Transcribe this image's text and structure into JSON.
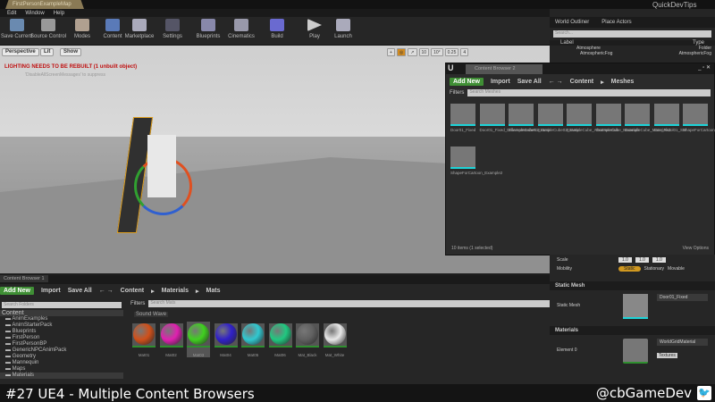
{
  "window": {
    "map_tab": "FirstPersonExampleMap",
    "project": "QuickDevTips",
    "menu": [
      "Edit",
      "Window",
      "Help"
    ]
  },
  "toolbar": [
    "Save Current",
    "Source Control",
    "Modes",
    "Content",
    "Marketplace",
    "Settings",
    "Blueprints",
    "Cinematics",
    "Build",
    "Play",
    "Launch"
  ],
  "viewport": {
    "perspective": "Perspective",
    "lit": "Lit",
    "show": "Show",
    "warning": "LIGHTING NEEDS TO BE REBUILT (1 unbuilt object)",
    "sub": "'DisableAllScreenMessages' to suppress",
    "snap": [
      "10",
      "10°",
      "0.25",
      "4"
    ]
  },
  "outliner": {
    "tabs": [
      "World Outliner",
      "Place Actors"
    ],
    "search_placeholder": "Search...",
    "col_label": "Label",
    "col_type": "Type",
    "rows": [
      {
        "label": "Atmosphere",
        "type": "Folder"
      },
      {
        "label": "AtmosphericFog",
        "type": "AtmosphericFog"
      }
    ]
  },
  "cb2": {
    "tab": "Content Browser 2",
    "add_new": "Add New",
    "import": "Import",
    "save_all": "Save All",
    "path": [
      "Content",
      "Meshes"
    ],
    "filters": "Filters",
    "search_placeholder": "Search Meshes",
    "items": [
      "Door01_Fixed",
      "Door01_Fixed_DifferentMeshes",
      "ExampleCube01_Static",
      "ExampleCube02_Static",
      "ExampleCube_AlterMaterials",
      "ExampleCube_Materials",
      "ExampleCube_Materials2",
      "Gun_Pistol01_SM",
      "ShapeForCartoon_Example",
      "ShapeForCartoon_Example2"
    ],
    "status": "10 items (1 selected)",
    "view_options": "View Options"
  },
  "details": {
    "scale_label": "Scale",
    "scale": [
      "1.0",
      "1.0",
      "1.0"
    ],
    "mobility_label": "Mobility",
    "mobility": [
      "Static",
      "Stationary",
      "Movable"
    ],
    "static_mesh_section": "Static Mesh",
    "static_mesh_label": "Static Mesh",
    "static_mesh_value": "Door01_Fixed",
    "materials_section": "Materials",
    "element0": "Element 0",
    "material_value": "WorldGridMaterial",
    "textures": "Textures"
  },
  "cb1": {
    "tab": "Content Browser 1",
    "add_new": "Add New",
    "import": "Import",
    "save_all": "Save All",
    "path": [
      "Content",
      "Materials",
      "Mats"
    ],
    "filters": "Filters",
    "search_folders": "Search Folders",
    "search_placeholder": "Search Mats",
    "filter_chip": "Sound Wave",
    "tree_root": "Content",
    "tree": [
      "AnimExamples",
      "AnimStarterPack",
      "Blueprints",
      "FirstPerson",
      "FirstPersonBP",
      "GenericNPCAnimPack",
      "Geometry",
      "Mannequin",
      "Maps",
      "Materials"
    ],
    "materials": [
      {
        "name": "Mat01",
        "color": "#d0501a"
      },
      {
        "name": "Mat02",
        "color": "#e020b0"
      },
      {
        "name": "Mat03",
        "color": "#40d020"
      },
      {
        "name": "Mat04",
        "color": "#3020c8"
      },
      {
        "name": "Mat05",
        "color": "#30c8d0"
      },
      {
        "name": "Mat06",
        "color": "#20c880"
      },
      {
        "name": "Mat_Black",
        "color": "#606060"
      },
      {
        "name": "Mat_White",
        "color": "#e8e8e8"
      }
    ]
  },
  "caption": {
    "title": "#27 UE4 - Multiple Content Browsers",
    "handle": "@cbGameDev"
  }
}
